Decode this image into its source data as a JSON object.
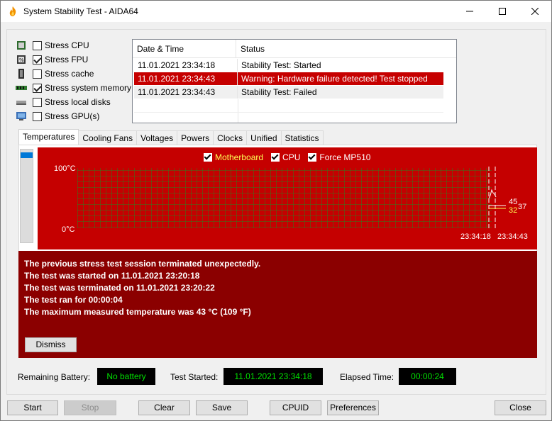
{
  "window": {
    "title": "System Stability Test - AIDA64"
  },
  "options": [
    {
      "label": "Stress CPU",
      "checked": false,
      "icon": "cpu-icon"
    },
    {
      "label": "Stress FPU",
      "checked": true,
      "icon": "fpu-icon"
    },
    {
      "label": "Stress cache",
      "checked": false,
      "icon": "cache-icon"
    },
    {
      "label": "Stress system memory",
      "checked": true,
      "icon": "memory-icon"
    },
    {
      "label": "Stress local disks",
      "checked": false,
      "icon": "disk-icon"
    },
    {
      "label": "Stress GPU(s)",
      "checked": false,
      "icon": "gpu-icon"
    }
  ],
  "log": {
    "headers": [
      "Date & Time",
      "Status"
    ],
    "rows": [
      {
        "datetime": "11.01.2021 23:34:18",
        "status": "Stability Test: Started"
      },
      {
        "datetime": "11.01.2021 23:34:43",
        "status": "Warning: Hardware failure detected! Test stopped"
      },
      {
        "datetime": "11.01.2021 23:34:43",
        "status": "Stability Test: Failed"
      }
    ]
  },
  "tabs": [
    "Temperatures",
    "Cooling Fans",
    "Voltages",
    "Powers",
    "Clocks",
    "Unified",
    "Statistics"
  ],
  "chart": {
    "legend": [
      "Motherboard",
      "CPU",
      "Force MP510"
    ],
    "y_top": "100°C",
    "y_bottom": "0°C",
    "time_start": "23:34:18",
    "time_end": "23:34:43",
    "value_a": "45",
    "value_b": "32",
    "value_c": "37",
    "colors": {
      "background": "#c50000",
      "grid": "#2e7d1e",
      "motherboard": "#ffff55"
    }
  },
  "alert": {
    "lines": [
      "The previous stress test session terminated unexpectedly.",
      "The test was started on 11.01.2021 23:20:18",
      "The test was terminated on 11.01.2021 23:20:22",
      "The test ran for 00:00:04",
      "The maximum measured temperature was 43 °C  (109 °F)"
    ],
    "dismiss_label": "Dismiss"
  },
  "status": {
    "battery_label": "Remaining Battery:",
    "battery_value": "No battery",
    "started_label": "Test Started:",
    "started_value": "11.01.2021 23:34:18",
    "elapsed_label": "Elapsed Time:",
    "elapsed_value": "00:00:24"
  },
  "buttons": {
    "start": "Start",
    "stop": "Stop",
    "clear": "Clear",
    "save": "Save",
    "cpuid": "CPUID",
    "preferences": "Preferences",
    "close": "Close"
  }
}
